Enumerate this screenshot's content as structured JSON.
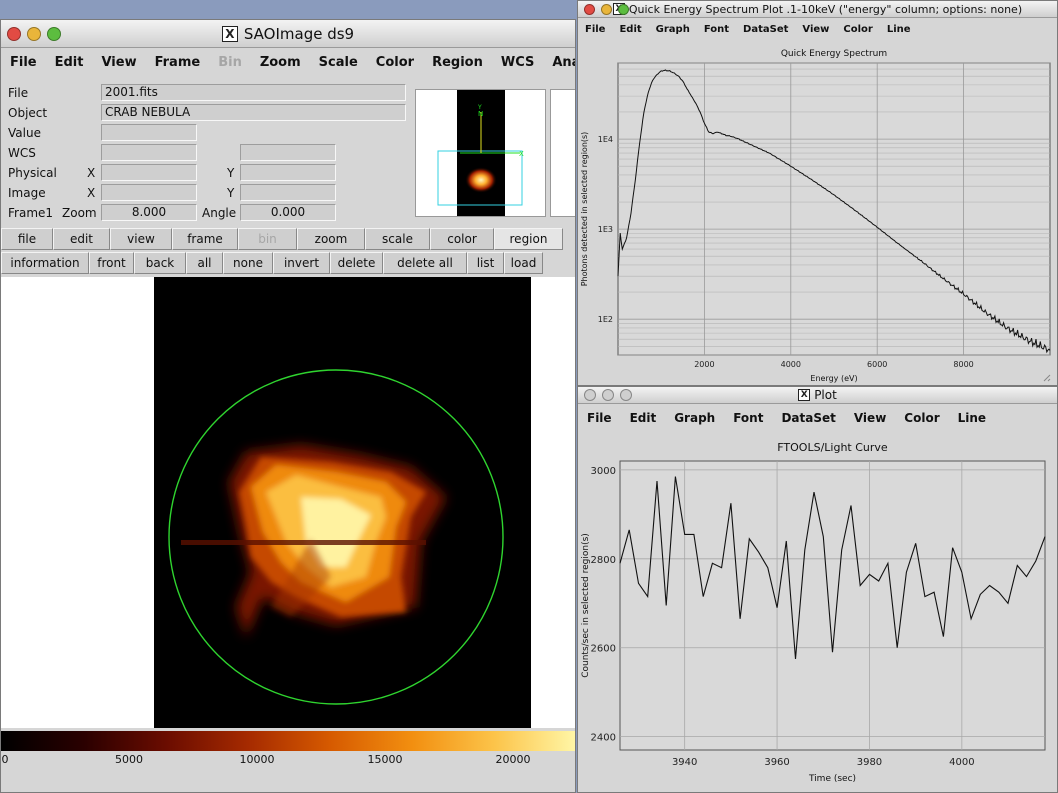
{
  "ds9": {
    "title": "SAOImage ds9",
    "menus": [
      "File",
      "Edit",
      "View",
      "Frame",
      "Bin",
      "Zoom",
      "Scale",
      "Color",
      "Region",
      "WCS",
      "Analysis"
    ],
    "disabled_menu": "Bin",
    "info": {
      "file_label": "File",
      "file_value": "2001.fits",
      "object_label": "Object",
      "object_value": "CRAB NEBULA",
      "value_label": "Value",
      "wcs_label": "WCS",
      "physical_label": "Physical",
      "image_label": "Image",
      "x_label": "X",
      "y_label": "Y",
      "frame_label": "Frame1",
      "zoom_label": "Zoom",
      "zoom_value": "8.000",
      "angle_label": "Angle",
      "angle_value": "0.000"
    },
    "button_row1": [
      "file",
      "edit",
      "view",
      "frame",
      "bin",
      "zoom",
      "scale",
      "color",
      "region"
    ],
    "button_row2": [
      "information",
      "front",
      "back",
      "all",
      "none",
      "invert",
      "delete",
      "delete all",
      "list",
      "load"
    ],
    "colorbar_ticks": [
      "0",
      "5000",
      "10000",
      "15000",
      "20000"
    ],
    "colorbar_tick_values": [
      0,
      5000,
      10000,
      15000,
      20000
    ],
    "colorbar_max": 22500,
    "colorbar_colors": [
      "#000000",
      "#2a0000",
      "#6a0c00",
      "#a52a00",
      "#d65a00",
      "#f28f10",
      "#fcc44a",
      "#fff7a8"
    ]
  },
  "spectrum_window": {
    "title": "Quick Energy Spectrum Plot .1-10keV (\"energy\" column; options: none)",
    "menus": [
      "File",
      "Edit",
      "Graph",
      "Font",
      "DataSet",
      "View",
      "Color",
      "Line"
    ]
  },
  "lightcurve_window": {
    "title": "Plot",
    "menus": [
      "File",
      "Edit",
      "Graph",
      "Font",
      "DataSet",
      "View",
      "Color",
      "Line"
    ]
  },
  "chart_data": [
    {
      "type": "line",
      "title": "Quick Energy Spectrum",
      "xlabel": "Energy (eV)",
      "ylabel": "Photons detected in selected region(s)",
      "xlim": [
        0,
        10000
      ],
      "ylim": [
        40,
        70000
      ],
      "yscale": "log",
      "grid": true,
      "x_ticks": [
        2000,
        4000,
        6000,
        8000
      ],
      "y_ticks": [
        100,
        1000,
        10000
      ],
      "y_tick_labels": [
        "1E2",
        "1E3",
        "1E4"
      ],
      "x": [
        0,
        50,
        100,
        200,
        300,
        400,
        500,
        600,
        700,
        800,
        900,
        1000,
        1100,
        1200,
        1300,
        1400,
        1500,
        1600,
        1700,
        1800,
        1900,
        2000,
        2100,
        2200,
        2300,
        2400,
        2500,
        2600,
        2800,
        3000,
        3500,
        4000,
        4500,
        5000,
        5500,
        6000,
        6500,
        7000,
        7500,
        8000,
        8500,
        9000,
        9500,
        10000
      ],
      "y": [
        300,
        900,
        600,
        800,
        1500,
        3500,
        9000,
        20000,
        33000,
        45000,
        52000,
        57000,
        58000,
        57000,
        54000,
        50000,
        44000,
        36000,
        30000,
        25000,
        20000,
        15000,
        12000,
        11500,
        12000,
        11500,
        11000,
        10800,
        10000,
        9000,
        7000,
        5000,
        3500,
        2400,
        1600,
        1050,
        680,
        450,
        290,
        190,
        120,
        80,
        58,
        45
      ]
    },
    {
      "type": "line",
      "title": "FTOOLS/Light Curve",
      "xlabel": "Time (sec)",
      "ylabel": "Counts/sec in selected region(s)",
      "xlim": [
        3926,
        4018
      ],
      "ylim": [
        2370,
        3020
      ],
      "grid": true,
      "x_ticks": [
        3940,
        3960,
        3980,
        4000
      ],
      "y_ticks": [
        2400,
        2600,
        2800,
        3000
      ],
      "x": [
        3926,
        3928,
        3930,
        3932,
        3934,
        3936,
        3938,
        3940,
        3942,
        3944,
        3946,
        3948,
        3950,
        3952,
        3954,
        3956,
        3958,
        3960,
        3962,
        3964,
        3966,
        3968,
        3970,
        3972,
        3974,
        3976,
        3978,
        3980,
        3982,
        3984,
        3986,
        3988,
        3990,
        3992,
        3994,
        3996,
        3998,
        4000,
        4002,
        4004,
        4006,
        4008,
        4010,
        4012,
        4014,
        4016,
        4018
      ],
      "y": [
        2790,
        2865,
        2745,
        2715,
        2975,
        2695,
        2985,
        2855,
        2855,
        2715,
        2790,
        2780,
        2925,
        2665,
        2845,
        2815,
        2780,
        2690,
        2840,
        2575,
        2820,
        2950,
        2850,
        2590,
        2820,
        2920,
        2740,
        2765,
        2750,
        2790,
        2600,
        2770,
        2835,
        2715,
        2725,
        2625,
        2825,
        2770,
        2665,
        2720,
        2740,
        2725,
        2700,
        2785,
        2760,
        2795,
        2850
      ]
    }
  ]
}
